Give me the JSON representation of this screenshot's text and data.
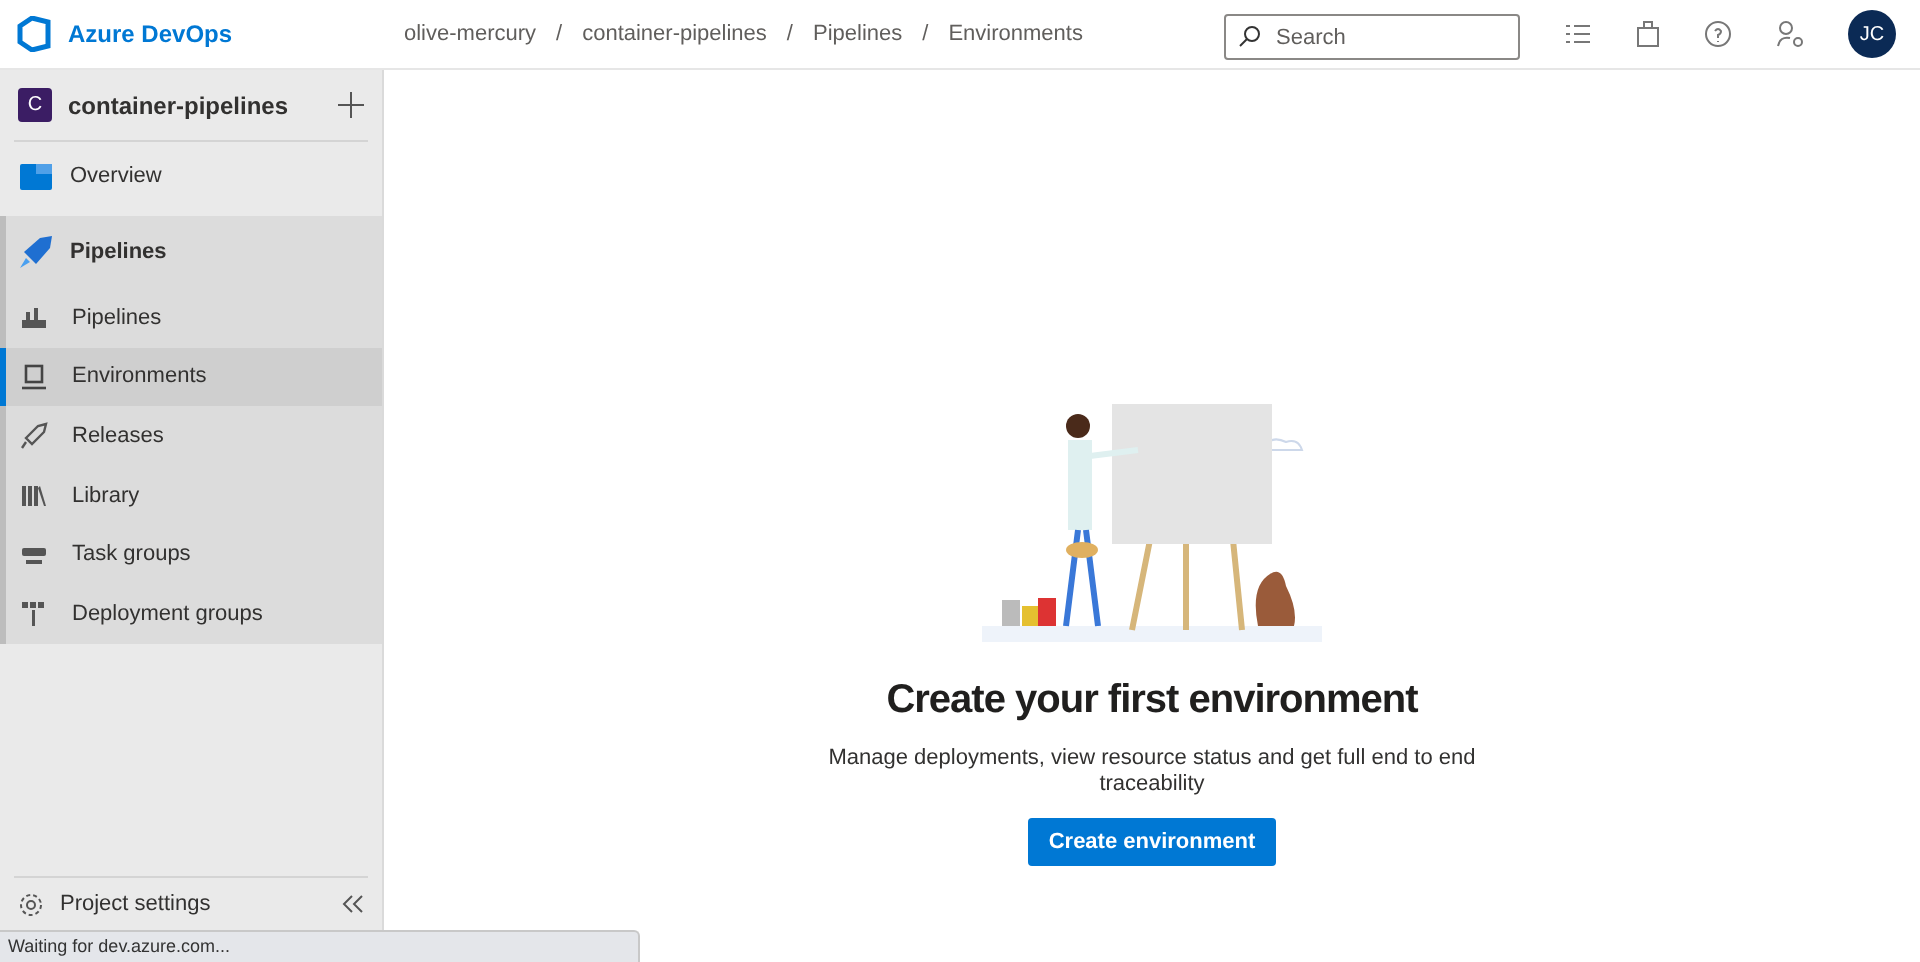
{
  "header": {
    "brand": "Azure DevOps",
    "breadcrumb": [
      "olive-mercury",
      "container-pipelines",
      "Pipelines",
      "Environments"
    ],
    "separator": "/",
    "search": {
      "placeholder": "Search"
    },
    "avatar": "JC"
  },
  "sidebar": {
    "project": {
      "initial": "C",
      "name": "container-pipelines"
    },
    "items": [
      {
        "label": "Overview",
        "kind": "overview",
        "selected": false
      },
      {
        "label": "Pipelines",
        "kind": "pipelines-hub",
        "selected": false,
        "children": [
          {
            "label": "Pipelines",
            "kind": "pipelines",
            "selected": false
          },
          {
            "label": "Environments",
            "kind": "environments",
            "selected": true
          },
          {
            "label": "Releases",
            "kind": "releases",
            "selected": false
          },
          {
            "label": "Library",
            "kind": "library",
            "selected": false
          },
          {
            "label": "Task groups",
            "kind": "taskgroups",
            "selected": false
          },
          {
            "label": "Deployment groups",
            "kind": "deploymentgroups",
            "selected": false
          }
        ]
      }
    ],
    "footer": "Project settings"
  },
  "main": {
    "title": "Create your first environment",
    "description": "Manage deployments, view resource status and get full end to end traceability",
    "button": "Create environment"
  },
  "status_bar": "Waiting for dev.azure.com..."
}
